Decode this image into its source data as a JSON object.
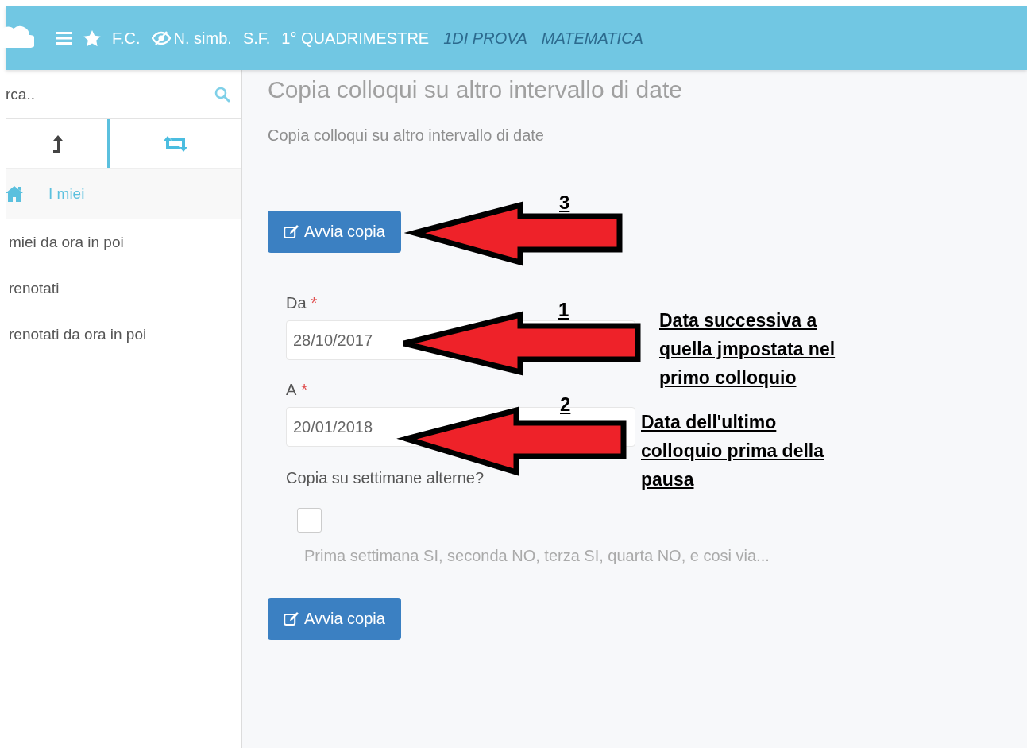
{
  "topbar": {
    "shortcuts": [
      {
        "label": "F.C.",
        "kind": "star"
      },
      {
        "label": "N. simb.",
        "kind": "hidden"
      },
      {
        "label": "S.F.",
        "kind": "plain"
      },
      {
        "label": "1° QUADRIMESTRE",
        "kind": "plain"
      }
    ],
    "context": [
      {
        "label": "1DI PROVA"
      },
      {
        "label": "MATEMATICA"
      }
    ]
  },
  "sidebar": {
    "search": {
      "value": "rca.."
    },
    "tabs": [
      {
        "kind": "upload",
        "selected": false
      },
      {
        "kind": "swap",
        "selected": true
      }
    ],
    "items": [
      {
        "label": "I miei",
        "kind": "home",
        "selected": true
      },
      {
        "label": "miei da ora in poi",
        "kind": "plain",
        "selected": false
      },
      {
        "label": "renotati",
        "kind": "plain",
        "selected": false
      },
      {
        "label": "renotati da ora in poi",
        "kind": "plain",
        "selected": false
      }
    ]
  },
  "main": {
    "title": "Copia colloqui su altro intervallo di date",
    "subtitle": "Copia colloqui su altro intervallo di date",
    "top_button": {
      "label": "Avvia copia"
    },
    "fields": [
      {
        "label": "Da",
        "required_mark": "*",
        "value": "28/10/2017"
      },
      {
        "label": "A",
        "required_mark": "*",
        "value": "20/01/2018"
      }
    ],
    "alternate_weeks": {
      "question": "Copia su settimane alterne?",
      "checked": false,
      "help": "Prima settimana SI, seconda NO, terza SI, quarta NO, e cosi via..."
    },
    "bottom_button": {
      "label": "Avvia copia"
    }
  },
  "annotations": [
    {
      "number": "3"
    },
    {
      "number": "1",
      "note": "Data successiva a quella jmpostata nel primo colloquio"
    },
    {
      "number": "2",
      "note": "Data dell'ultimo colloquio prima della pausa"
    }
  ]
}
